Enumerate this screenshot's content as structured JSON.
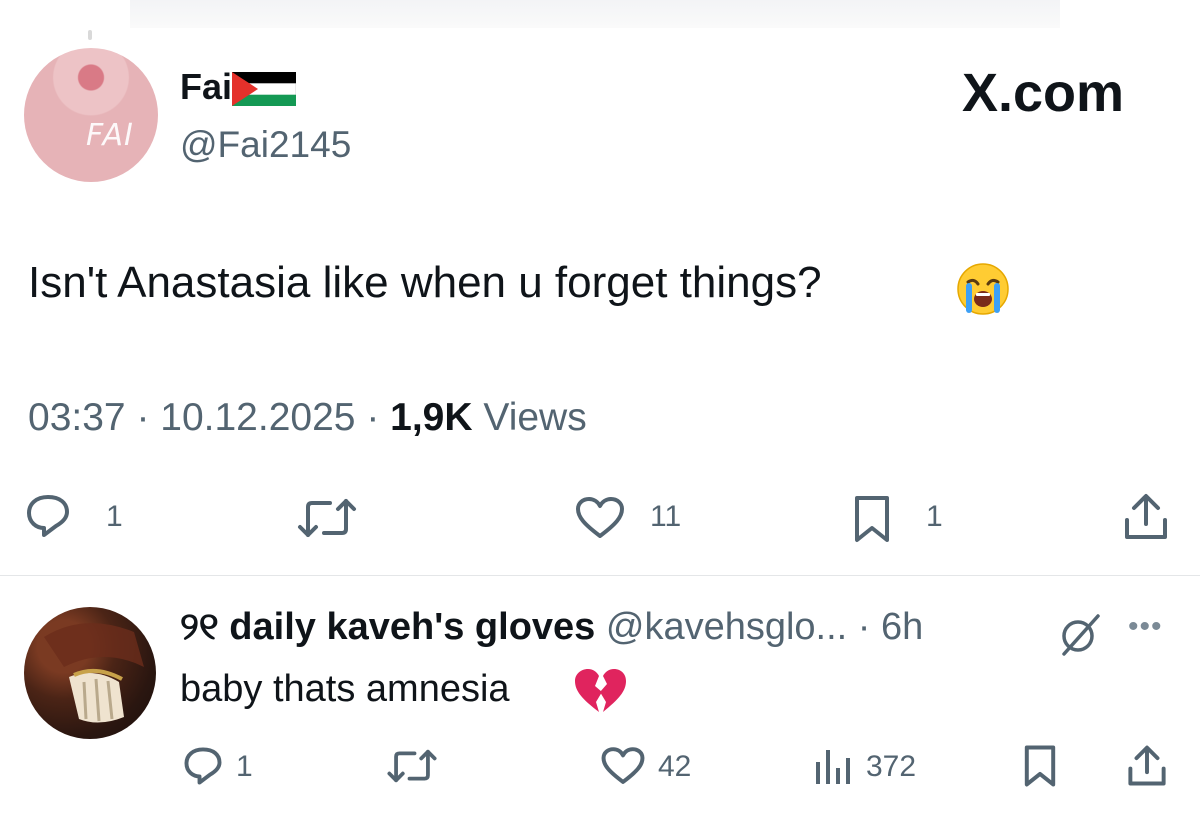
{
  "tweet": {
    "author_name": "Fai",
    "author_handle": "@Fai2145",
    "brand": "X.com",
    "avatar_mark": "FAI",
    "text": "Isn't Anastasia like when u forget things?",
    "emoji": "loudly-crying-face",
    "time": "03:37",
    "date": "10.12.2025",
    "views_count": "1,9K",
    "views_label": "Views",
    "actions": {
      "reply_count": "1",
      "retweet_count": "",
      "like_count": "11",
      "bookmark_count": "1"
    }
  },
  "reply": {
    "name_prefix": "୨୧",
    "name": "daily kaveh's gloves",
    "handle": "@kavehsglo...",
    "separator": "·",
    "time": "6h",
    "text": "baby thats amnesia",
    "emoji": "broken-heart",
    "more": "•••",
    "actions": {
      "reply_count": "1",
      "retweet_count": "",
      "like_count": "42",
      "views_count": "372"
    }
  },
  "colors": {
    "text": "#0f1419",
    "secondary": "#536471",
    "divider": "#e4e6e8",
    "heart_broken": "#e0245e",
    "flag_green": "#149954",
    "flag_red": "#e4312b"
  }
}
